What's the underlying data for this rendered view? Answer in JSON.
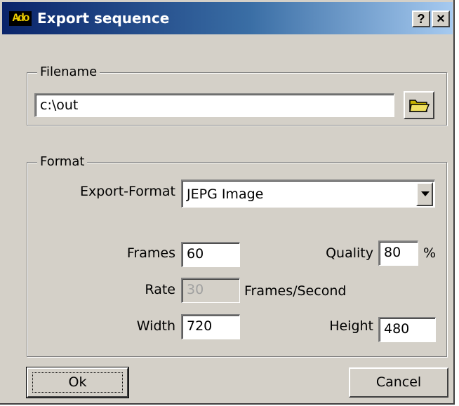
{
  "window": {
    "app_icon_text": "Ado",
    "title": "Export sequence",
    "help_button": "?",
    "close_button": "×"
  },
  "filename_group": {
    "legend": "Filename",
    "value": "c:\\out",
    "browse_icon": "folder-icon"
  },
  "format_group": {
    "legend": "Format",
    "export_format_label": "Export-Format",
    "export_format_value": "JEPG Image",
    "frames_label": "Frames",
    "frames_value": "60",
    "quality_label": "Quality",
    "quality_value": "80",
    "quality_unit": "%",
    "rate_label": "Rate",
    "rate_value": "30",
    "rate_unit": "Frames/Second",
    "width_label": "Width",
    "width_value": "720",
    "height_label": "Height",
    "height_value": "480"
  },
  "buttons": {
    "ok_label": "Ok",
    "cancel_label": "Cancel"
  }
}
